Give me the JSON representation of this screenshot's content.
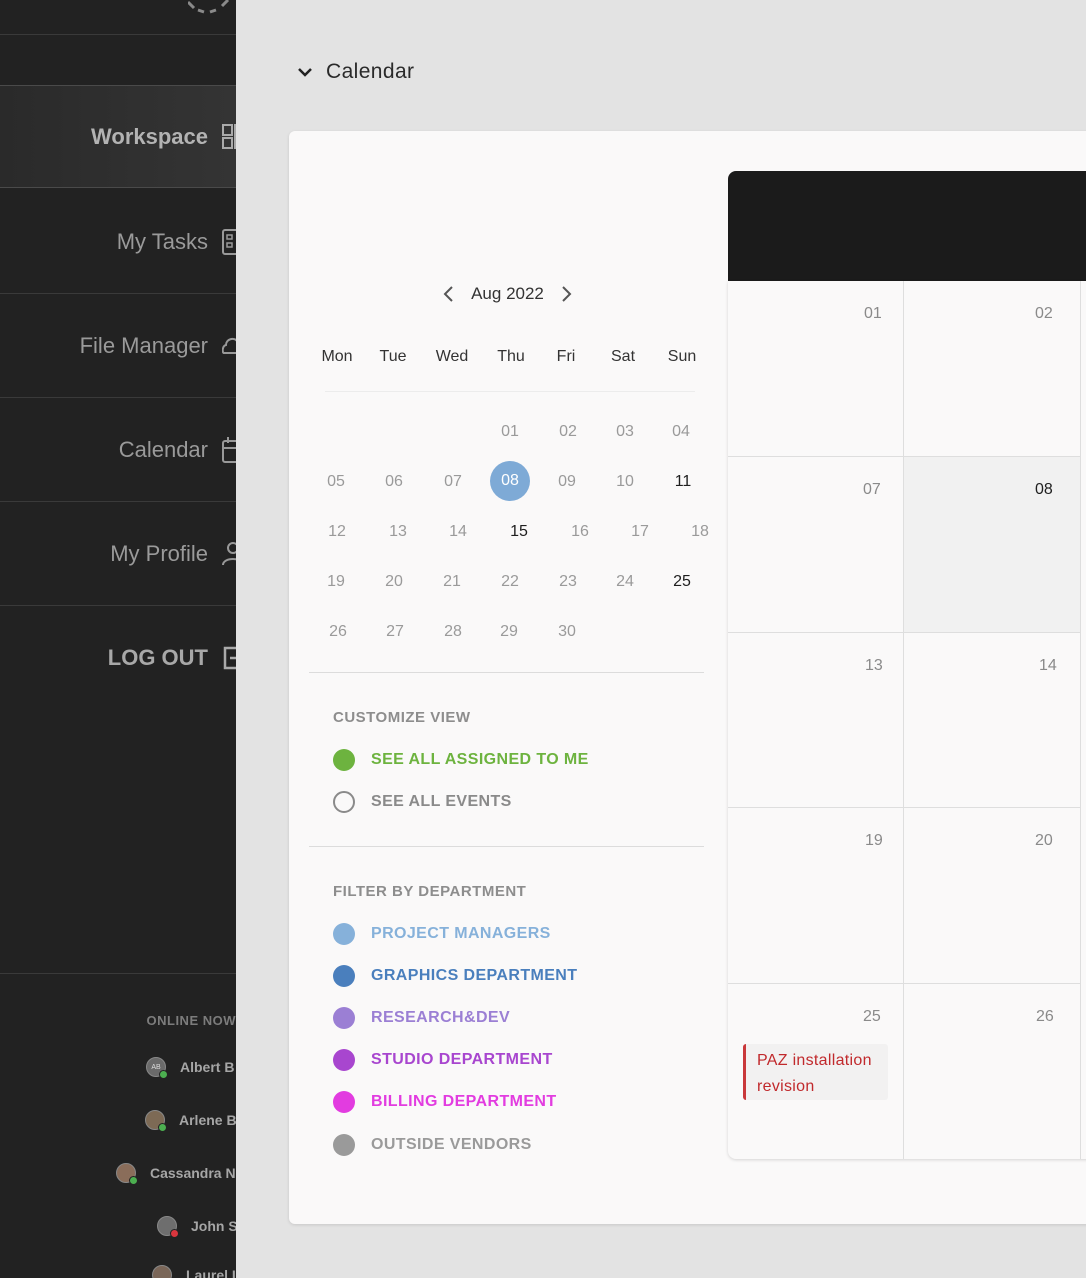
{
  "sidebar": {
    "nav": [
      {
        "label": "Workspace",
        "icon": "dashboard-icon"
      },
      {
        "label": "My Tasks",
        "icon": "tasks-icon"
      },
      {
        "label": "File Manager",
        "icon": "cloud-icon"
      },
      {
        "label": "Calendar",
        "icon": "calendar-icon"
      },
      {
        "label": "My Profile",
        "icon": "user-icon"
      },
      {
        "label": "LOG OUT",
        "icon": "logout-icon"
      }
    ],
    "online_title": "ONLINE NOW",
    "online_users": [
      {
        "name": "Albert B",
        "initials": "AB",
        "status_color": "#4caf50"
      },
      {
        "name": "Arlene B",
        "initials": "",
        "status_color": "#4caf50"
      },
      {
        "name": "Cassandra N",
        "initials": "",
        "status_color": "#4caf50"
      },
      {
        "name": "John S",
        "initials": "",
        "status_color": "#d9363e"
      },
      {
        "name": "Laurel I",
        "initials": "",
        "status_color": "#4caf50"
      }
    ]
  },
  "section": {
    "title": "Calendar"
  },
  "mini_calendar": {
    "month_label": "Aug 2022",
    "weekdays": [
      "Mon",
      "Tue",
      "Wed",
      "Thu",
      "Fri",
      "Sat",
      "Sun"
    ],
    "weeks": [
      [
        "",
        "",
        "",
        "01",
        "02",
        "03",
        "04"
      ],
      [
        "05",
        "06",
        "07",
        "08",
        "09",
        "10",
        "11"
      ],
      [
        "12",
        "13",
        "14",
        "15",
        "16",
        "17",
        "18"
      ],
      [
        "19",
        "20",
        "21",
        "22",
        "23",
        "24",
        "25"
      ],
      [
        "26",
        "27",
        "28",
        "29",
        "30",
        "",
        ""
      ]
    ],
    "selected": "08",
    "bold_days": [
      "11",
      "15",
      "25"
    ]
  },
  "customize_view": {
    "title": "CUSTOMIZE VIEW",
    "options": [
      {
        "label": "SEE ALL ASSIGNED TO ME",
        "color": "#6db33f",
        "selected": true
      },
      {
        "label": "SEE ALL EVENTS",
        "color": "#8a8a8a",
        "selected": false
      }
    ]
  },
  "filter_department": {
    "title": "FILTER BY DEPARTMENT",
    "items": [
      {
        "label": "PROJECT MANAGERS",
        "color": "#86b1da"
      },
      {
        "label": "GRAPHICS DEPARTMENT",
        "color": "#4a7fbd"
      },
      {
        "label": "RESEARCH&DEV",
        "color": "#9b7fd4"
      },
      {
        "label": "STUDIO DEPARTMENT",
        "color": "#a846cf"
      },
      {
        "label": "BILLING DEPARTMENT",
        "color": "#e23ce0"
      },
      {
        "label": "OUTSIDE VENDORS",
        "color": "#9a9a9a"
      }
    ]
  },
  "month_grid": {
    "rows": [
      [
        "01",
        "02"
      ],
      [
        "07",
        "08"
      ],
      [
        "13",
        "14"
      ],
      [
        "19",
        "20"
      ],
      [
        "25",
        "26"
      ]
    ],
    "today": "08",
    "event": {
      "line1": "PAZ installation",
      "line2": "revision",
      "color": "#c9383a"
    }
  }
}
